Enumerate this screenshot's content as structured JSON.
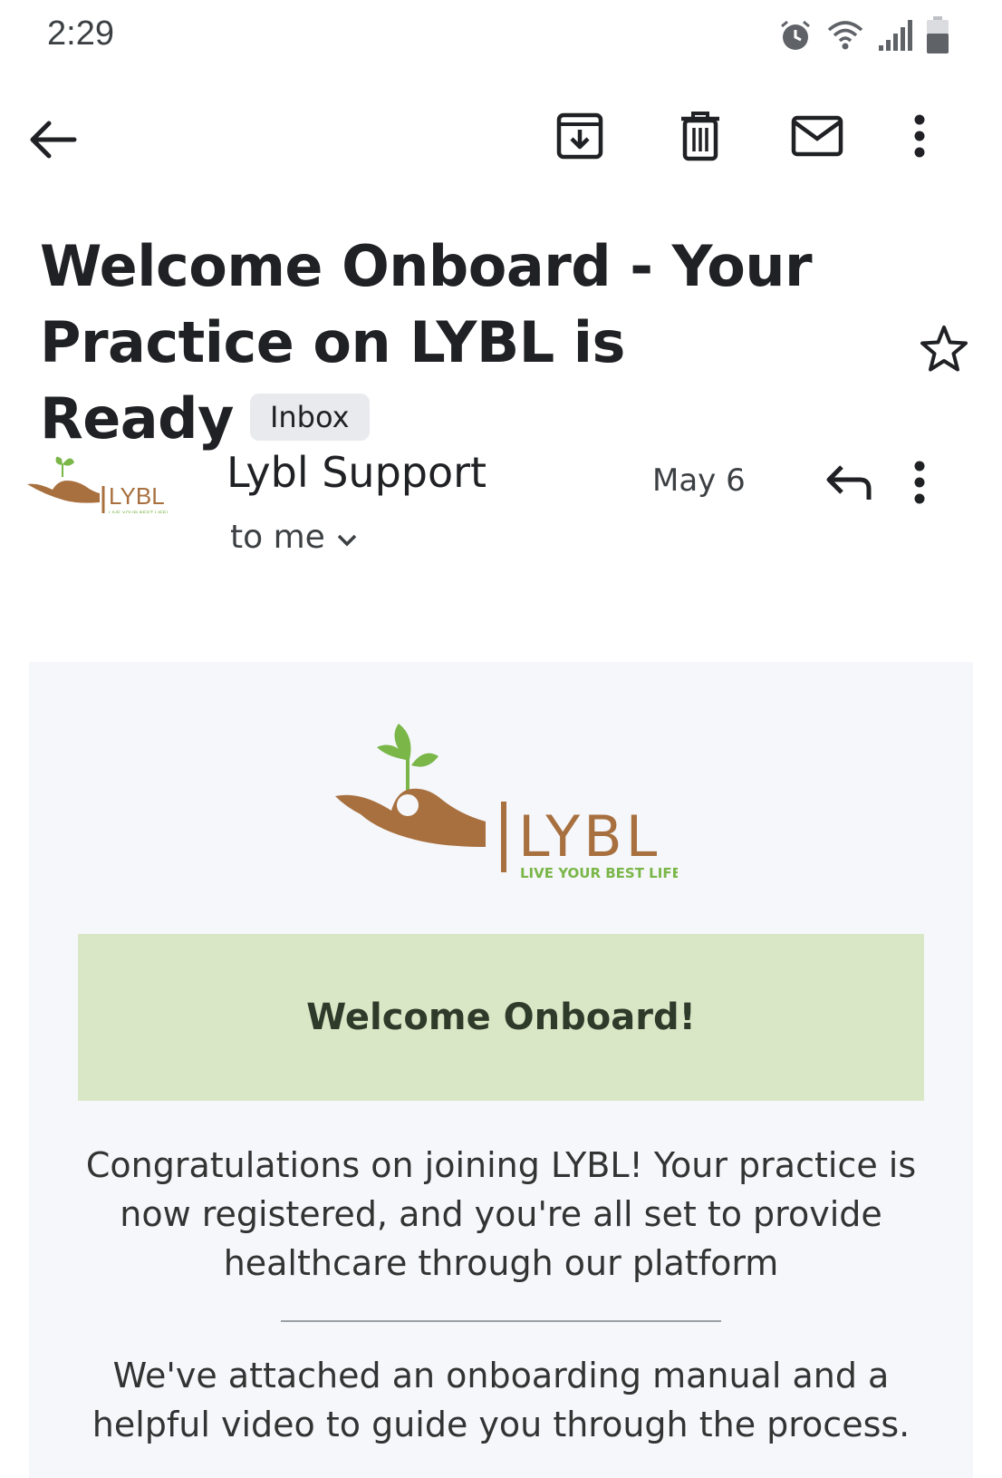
{
  "status_bar": {
    "time": "2:29",
    "icons": [
      "alarm-icon",
      "wifi-icon",
      "signal-icon",
      "battery-icon"
    ]
  },
  "toolbar": {
    "icons": [
      "back-arrow-icon",
      "archive-icon",
      "delete-icon",
      "mark-unread-icon",
      "more-vert-icon"
    ]
  },
  "email": {
    "subject": "Welcome Onboard - Your Practice on LYBL is Ready",
    "label": "Inbox",
    "starred": false,
    "sender": "Lybl Support",
    "recipient": "to me",
    "date": "May 6"
  },
  "body": {
    "logo_text": "LYBL",
    "logo_tagline": "LIVE YOUR BEST LIFE!",
    "banner_title": "Welcome Onboard!",
    "paragraph_1": "Congratulations on joining LYBL! Your practice is now registered, and you're all set to provide healthcare through our platform",
    "paragraph_2": "We've attached an onboarding manual and a helpful video to guide you through the process."
  },
  "colors": {
    "brand_brown": "#a8703f",
    "brand_green": "#7ab648",
    "banner_bg": "#d9e7c6",
    "body_bg": "#f5f7fb"
  }
}
